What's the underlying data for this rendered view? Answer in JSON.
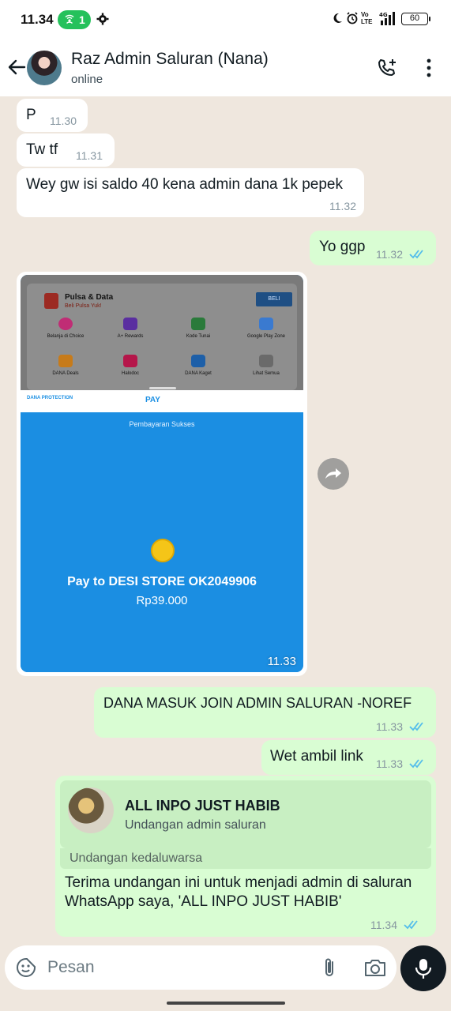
{
  "status_bar": {
    "time": "11.34",
    "hotspot_count": "1",
    "volte_label": "Vo\nLTE",
    "network_label": "4G",
    "battery": "60",
    "icons": [
      "hotspot-icon",
      "gear-icon",
      "moon-icon",
      "alarm-icon",
      "signal-icon",
      "battery-icon"
    ]
  },
  "header": {
    "contact_name": "Raz Admin Saluran (Nana)",
    "status": "online",
    "icons": [
      "back-arrow-icon",
      "add-call-icon",
      "more-vertical-icon"
    ]
  },
  "messages": [
    {
      "id": "m1",
      "direction": "incoming",
      "text": "P",
      "time": "11.30"
    },
    {
      "id": "m2",
      "direction": "incoming",
      "text": "Tw tf",
      "time": "11.31"
    },
    {
      "id": "m3",
      "direction": "incoming",
      "text": "Wey gw isi saldo 40 kena admin dana 1k pepek",
      "time": "11.32"
    },
    {
      "id": "m4",
      "direction": "outgoing",
      "text": "Yo ggp",
      "time": "11.32",
      "read": true
    },
    {
      "id": "m5",
      "direction": "incoming",
      "type": "image",
      "time": "11.33",
      "image": {
        "pulsa_title": "Pulsa & Data",
        "pulsa_sub": "Beli Pulsa Yuk!",
        "beli": "BELI",
        "grid": [
          "Belanja di Choice",
          "A+ Rewards",
          "Kode Tunai",
          "Google Play Zone",
          "DANA Deals",
          "Halodoc",
          "DANA Kaget",
          "Lihat Semua"
        ],
        "protection": "DANA PROTECTION",
        "pay_logo": "PAY",
        "status": "Pembayaran Sukses",
        "pay_to": "Pay to DESI STORE OK2049906",
        "amount": "Rp39.000"
      }
    },
    {
      "id": "m6",
      "direction": "outgoing",
      "text": "DANA MASUK JOIN ADMIN SALURAN -NOREF",
      "time": "11.33",
      "read": true
    },
    {
      "id": "m7",
      "direction": "outgoing",
      "text": "Wet ambil link",
      "time": "11.33",
      "read": true
    },
    {
      "id": "m8",
      "direction": "outgoing",
      "type": "invite",
      "time": "11.34",
      "read": true,
      "invite": {
        "channel": "ALL INPO JUST HABIB",
        "subtitle": "Undangan admin saluran",
        "expired": "Undangan kedaluwarsa",
        "text": "Terima undangan ini untuk menjadi admin di saluran WhatsApp saya, 'ALL INPO JUST HABIB'"
      }
    }
  ],
  "input": {
    "placeholder": "Pesan",
    "icons": [
      "emoji-sticker-icon",
      "paperclip-icon",
      "camera-icon",
      "microphone-icon"
    ]
  },
  "colors": {
    "outgoing_bubble": "#d9fdd3",
    "incoming_bubble": "#ffffff",
    "read_ticks": "#53bdeb",
    "chat_bg": "#efe7de",
    "dana_blue": "#1b8ee2"
  }
}
